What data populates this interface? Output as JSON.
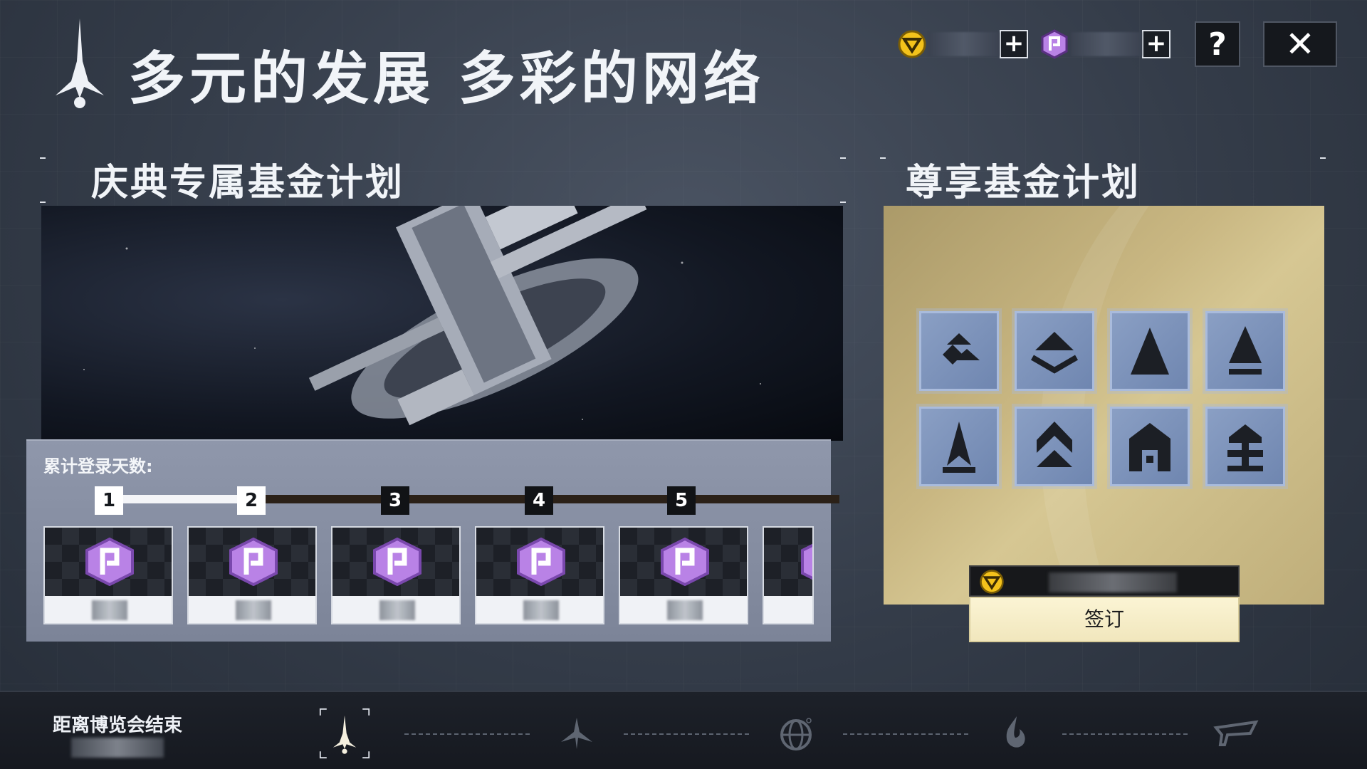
{
  "header": {
    "title": "多元的发展 多彩的网络",
    "currencies": [
      {
        "name": "gold-currency",
        "value": "",
        "color": "#f3c21b"
      },
      {
        "name": "purple-currency",
        "value": "",
        "color": "#b982e6"
      }
    ],
    "help_label": "?",
    "close_label": "✕"
  },
  "left_panel": {
    "title": "庆典专属基金计划",
    "login_label": "累计登录天数:",
    "days": [
      {
        "label": "1",
        "done": true
      },
      {
        "label": "2",
        "done": true
      },
      {
        "label": "3",
        "done": false
      },
      {
        "label": "4",
        "done": false
      },
      {
        "label": "5",
        "done": false
      }
    ],
    "rewards": [
      {
        "icon": "purple-currency-icon",
        "count": ""
      },
      {
        "icon": "purple-currency-icon",
        "count": ""
      },
      {
        "icon": "purple-currency-icon",
        "count": ""
      },
      {
        "icon": "purple-currency-icon",
        "count": ""
      },
      {
        "icon": "purple-currency-icon",
        "count": ""
      }
    ]
  },
  "right_panel": {
    "title": "尊享基金计划",
    "badges": [
      "rank-badge-1",
      "rank-badge-2",
      "rank-badge-3",
      "rank-badge-4",
      "rank-badge-5",
      "rank-badge-6",
      "rank-badge-7",
      "rank-badge-8"
    ],
    "price": "",
    "sign_label": "签订"
  },
  "bottom_bar": {
    "countdown_label": "距离博览会结束",
    "countdown_value": "",
    "nav": [
      "spire-icon",
      "tri-blade-icon",
      "globe-icon",
      "flame-icon",
      "wing-icon"
    ],
    "active_index": 0
  }
}
